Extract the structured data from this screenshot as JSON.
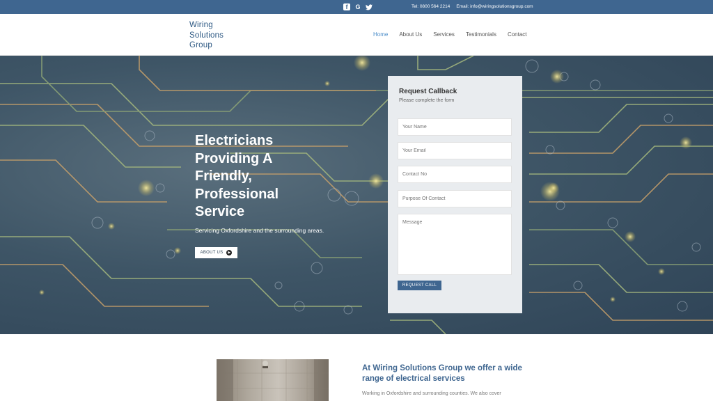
{
  "topbar": {
    "social_icons": [
      "facebook-icon",
      "google-icon",
      "twitter-icon"
    ],
    "phone": "Tel: 0800 564 2214",
    "email": "Email: info@wiringsolutionsgroup.com"
  },
  "header": {
    "logo_lines": [
      "Wiring",
      "Solutions",
      "Group"
    ],
    "nav": [
      {
        "label": "Home",
        "active": true
      },
      {
        "label": "About Us",
        "active": false
      },
      {
        "label": "Services",
        "active": false
      },
      {
        "label": "Testimonials",
        "active": false
      },
      {
        "label": "Contact",
        "active": false
      }
    ]
  },
  "hero": {
    "title_lines": [
      "Electricians",
      "Providing A",
      "Friendly,",
      "Professional",
      "Service"
    ],
    "subtitle": "Servicing Oxfordshire and the surrounding areas.",
    "button_label": "ABOUT US"
  },
  "form": {
    "title": "Request Callback",
    "subtitle": "Please complete the form",
    "fields": [
      {
        "placeholder": "Your Name"
      },
      {
        "placeholder": "Your Email"
      },
      {
        "placeholder": "Contact No"
      },
      {
        "placeholder": "Purpose Of Contact"
      },
      {
        "placeholder": "Message"
      }
    ],
    "submit_label": "REQUEST CALL"
  },
  "intro": {
    "heading": "At Wiring Solutions Group we offer a wide range of electrical services",
    "text": "Working in Oxfordshire and surrounding counties. We also cover"
  },
  "colors": {
    "brand": "#3f6690",
    "nav_active": "#4a8cc9"
  }
}
